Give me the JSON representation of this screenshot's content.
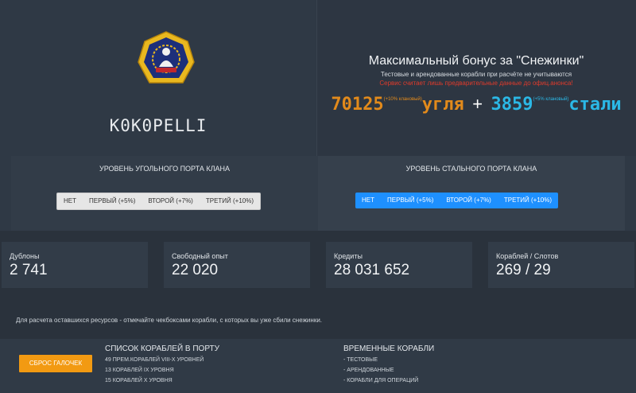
{
  "clan": {
    "name": "K0K0PELLI"
  },
  "bonus": {
    "title": "Максимальный бонус за \"Снежинки\"",
    "subtitle": "Тестовые и арендованные корабли при расчёте не учитываются",
    "warning": "Сервис считает лишь предварительные данные до офиц.анонса!",
    "coal_value": "70125",
    "coal_note": "(+10% клановый)",
    "coal_word": "угля",
    "plus": "+",
    "steel_value": "3859",
    "steel_note": "(+5% клановый)",
    "steel_word": "стали"
  },
  "ports": {
    "coal": {
      "title": "УРОВЕНЬ УГОЛЬНОГО ПОРТА КЛАНА",
      "options": [
        "НЕТ",
        "ПЕРВЫЙ (+5%)",
        "ВТОРОЙ (+7%)",
        "ТРЕТИЙ (+10%)"
      ]
    },
    "steel": {
      "title": "УРОВЕНЬ СТАЛЬНОГО ПОРТА КЛАНА",
      "options": [
        "НЕТ",
        "ПЕРВЫЙ (+5%)",
        "ВТОРОЙ (+7%)",
        "ТРЕТИЙ (+10%)"
      ]
    }
  },
  "stats": [
    {
      "label": "Дублоны",
      "value": "2 741"
    },
    {
      "label": "Свободный опыт",
      "value": "22 020"
    },
    {
      "label": "Кредиты",
      "value": "28 031 652"
    },
    {
      "label": "Кораблей / Слотов",
      "value": "269 / 29"
    }
  ],
  "info": "Для расчета оставшихся ресурсов - отмечайте чекбоксами корабли, с которых вы уже сбили снежинки.",
  "bottom": {
    "reset_label": "СБРОС ГАЛОЧЕК",
    "ships_title": "СПИСОК КОРАБЛЕЙ В ПОРТУ",
    "ships": [
      "49 ПРЕМ.КОРАБЛЕЙ VIII-X УРОВНЕЙ",
      "13 КОРАБЛЕЙ IX УРОВНЯ",
      "15 КОРАБЛЕЙ X УРОВНЯ"
    ],
    "temp_title": "ВРЕМЕННЫЕ КОРАБЛИ",
    "temp": [
      "- ТЕСТОВЫЕ",
      "- АРЕНДОВАННЫЕ",
      "- КОРАБЛИ ДЛЯ ОПЕРАЦИЙ"
    ]
  },
  "colors": {
    "accent_blue": "#1e90ff",
    "orange": "#f29a12",
    "coal": "#e28a1b",
    "steel": "#2bb8e6"
  }
}
